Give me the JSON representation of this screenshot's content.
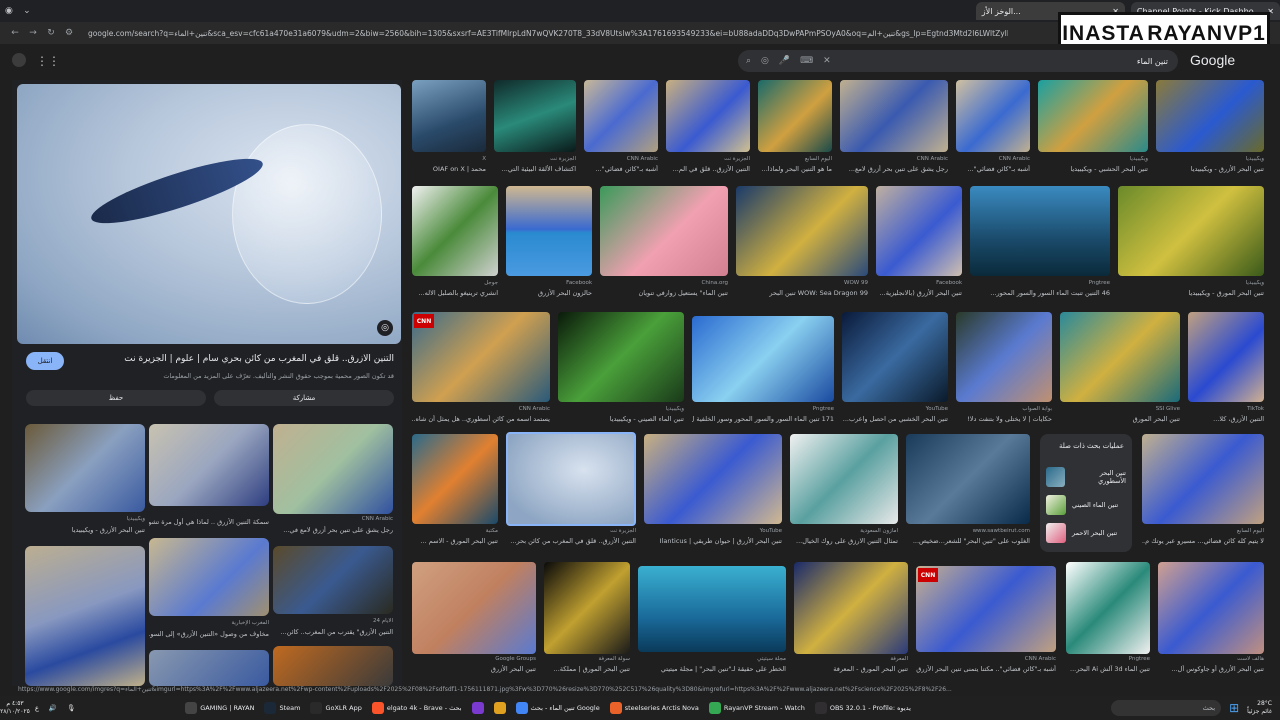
{
  "browser": {
    "tabs": [
      {
        "label": "الوخز الأز...",
        "active": true
      },
      {
        "label": "Channel Points - Kick Dashbo...",
        "active": false
      }
    ],
    "url": "google.com/search?q=تنين+الماء&sca_esv=cfc61a470e31a6079&udm=2&biw=2560&bih=1305&sxsrf=AE3TifMlrpLdN7wQVK270T8_33dV8Utslw%3A1761693549233&ei=bU88adaDDq3DwPAPmPSOyA0&oq=تنين+الم&gs_lp=Egtnd3Mtd2l6LWltZyIP2KrZhtmK2Ygg2KfZhNm4FKgllADIFEAAYgAQyBRAAGIAE..."
  },
  "watermark": {
    "left": "INASTA",
    "right": "RAYANVP1"
  },
  "search": {
    "query": "تنين الماء",
    "logo": "Google"
  },
  "panel": {
    "open_label": "انتقل",
    "title": "التنين الأزرق.. قلق في المغرب من كائن بحري سام | علوم | الجزيرة نت",
    "subtitle": "قد تكون الصور محمية بموجب حقوق النشر والتأليف. تعرّف على المزيد من المعلومات",
    "save_label": "حفظ",
    "share_label": "مشاركة",
    "related": [
      {
        "caption": "تنين البحر الأزرق - ويكيبيديا",
        "source": "ويكيبيديا"
      },
      {
        "caption": "سمكة التنين الأزرق .. لماذا هي أول مرة تشوهها...",
        "source": "الجزيرة"
      },
      {
        "caption": "رجل يشق على تنين بحر أزرق لامع في...",
        "source": "CNN Arabic"
      },
      {
        "caption": "مخاوف من وصول «التنين الأزرق» إلى السو...",
        "source": "المغرب الإخبارية"
      },
      {
        "caption": "التنين الأزرق\" يقترب من المغرب.. كائن...",
        "source": "الأيام 24"
      }
    ]
  },
  "results_row1": [
    {
      "caption": "محمد | OIAF on X",
      "source": "X"
    },
    {
      "caption": "اكتشاف الألقة البيئية التي...",
      "source": "الجزيرة نت"
    },
    {
      "caption": "أشبه بـ\"كائن فضائي\"...",
      "source": "CNN Arabic"
    },
    {
      "caption": "التنين الأزرق.. قلق في الم...",
      "source": "الجزيرة نت"
    },
    {
      "caption": "ما هو التنين البحر ولماذا...",
      "source": "اليوم السابع"
    },
    {
      "caption": "رجل يشق على تنين بحر أزرق لامع...",
      "source": "CNN Arabic"
    },
    {
      "caption": "أشبه بـ\"كائن فضائي\"...",
      "source": "CNN Arabic"
    },
    {
      "caption": "تنين البحر الحشبي - ويكيبيديا",
      "source": "ويكيبيديا"
    },
    {
      "caption": "تنين البحر الأزرق - ويكيبيديا",
      "source": "ويكيبيديا"
    }
  ],
  "results_row2": [
    {
      "caption": "انشري ترينيغو بالصلبل الاله...",
      "source": "جوجل"
    },
    {
      "caption": "حالزون البحر الأزرق",
      "source": "Facebook"
    },
    {
      "caption": "تنين الماء\" يستعيل زوارفي تنويان",
      "source": "China.org"
    },
    {
      "caption": "99 WOW: Sea Dragon تنين البحر",
      "source": "99 WOW"
    },
    {
      "caption": "تنين البحر الأزرق (بالانجليزية...",
      "source": "Facebook"
    },
    {
      "caption": "46 التنين تنبت الماء السور والسور المحور...",
      "source": "Pngtree"
    },
    {
      "caption": "تنين البحر المورق - ويكيبيديا",
      "source": "ويكيبيديا"
    }
  ],
  "results_row3": [
    {
      "caption": "يستمد اسمه من كائن أسطوري.. هل يمثل أن شاه...",
      "source": "CNN Arabic"
    },
    {
      "caption": "تنين الماء الصيني - ويكيبيديا",
      "source": "ويكيبيديا"
    },
    {
      "caption": "171 تنين الماء السور والسور المحور وسور الخلفية ل...",
      "source": "Pngtree"
    },
    {
      "caption": "تنين البحر الخشبي من احصل واعرب...",
      "source": "YouTube"
    },
    {
      "caption": "حكايات | لا يختلى ولا بتنفت دلا!",
      "source": "بوابة الصواب"
    },
    {
      "caption": "تنين البحر المورق",
      "source": "SSI Glive"
    },
    {
      "caption": "التنين الأزرق، كلا...",
      "source": "TikTok"
    }
  ],
  "results_row4": [
    {
      "caption": "تنين البحر المورق - الاسم ...",
      "source": "مكتبة"
    },
    {
      "caption": "التنين الأزرق.. قلق في المغرب من كائن بحر...",
      "source": "الجزيرة نت"
    },
    {
      "caption": "تنين البحر الأزرق | حيوان طريقي | Ilanticus",
      "source": "YouTube"
    },
    {
      "caption": "تمثال التنين الارزق على روك الخيال...",
      "source": "أمازون السعودية"
    },
    {
      "caption": "الغلوب على \"تنين البحر\" للشعر...ضخيص...",
      "source": "www.sawtbeirut.com"
    },
    {
      "caption": "لا يتيم كله كائن فضائي... مسيرو عبر يوتك م...",
      "source": "اليوم السابع"
    }
  ],
  "related_searches": {
    "heading": "عمليات بحث ذات صلة",
    "items": [
      "تنين البحر الأسطوري",
      "تنين الماء الصيني",
      "تنين البحر الاحمر"
    ]
  },
  "results_row5": [
    {
      "caption": "تنين البحر الأزرق",
      "source": "Google Groups"
    },
    {
      "caption": "تنين البحر المورق | مملكة...",
      "source": "سولة المعرفة"
    },
    {
      "caption": "الخطر على حقيقة لـ\"تنين البحر\" | مجلة ميتيتي",
      "source": "مجلة سيتيتي"
    },
    {
      "caption": "تنين البحر المورق - المعرفة",
      "source": "المعرفة"
    },
    {
      "caption": "أشبه بـ\"كائن فضائي\".. مكتنا يتمنى تنين البحر الأزرق...",
      "source": "CNN Arabic"
    },
    {
      "caption": "تنين الماء 3d آلش Ai البحر...",
      "source": "Pngtree"
    },
    {
      "caption": "تنين البحر الأزرق أو جاوكوس أل...",
      "source": "هالف لاست"
    }
  ],
  "status_url": "https://www.google.com/imgres?q=تنين+الماء&imgurl=https%3A%2F%2Fwww.aljazeera.net%2Fwp-content%2Fuploads%2F2025%2F08%2Fsdfsdf1-1756111871.jpg%3Fw%3D770%26resize%3D770%252C517%26quality%3D80&imgrefurl=https%3A%2F%2Fwww.aljazeera.net%2Fscience%2F2025%2F8%2F26...",
  "taskbar": {
    "clock": "٤:٥٣ م",
    "date": "٢٨/١٠/٢٠٢٥",
    "items": [
      "GAMING | RAYAN",
      "Steam",
      "GoXLR App",
      "elgato 4k - Brave - بحث",
      "تنين الماء - بحث Google",
      "steelseries Arctis Nova",
      "RayanVP Stream - Watch",
      "OBS 32.0.1 - Profile: يديوه"
    ],
    "search_placeholder": "بحث",
    "weather": "28°C",
    "weather_desc": "غائم جزئياً"
  },
  "colors": {
    "bg": "#1f1f1f",
    "accent": "#8ab4f8",
    "cnn": "#cc0000"
  }
}
